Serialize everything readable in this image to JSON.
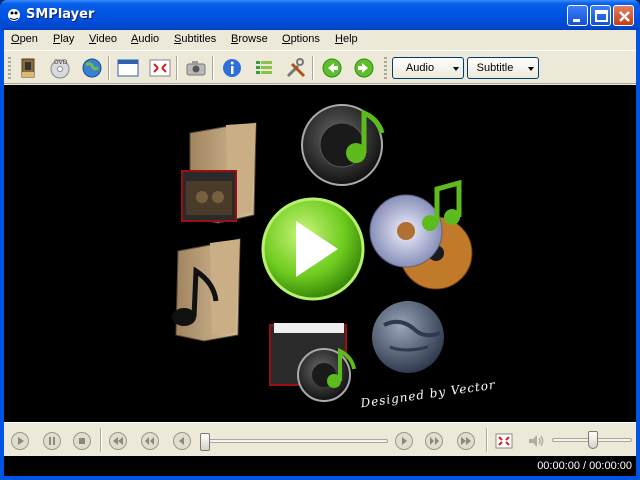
{
  "window": {
    "title": "SMPlayer"
  },
  "menu": [
    {
      "key": "O",
      "rest": "pen"
    },
    {
      "key": "P",
      "rest": "lay"
    },
    {
      "key": "V",
      "rest": "ideo"
    },
    {
      "key": "A",
      "rest": "udio"
    },
    {
      "key": "S",
      "rest": "ubtitles"
    },
    {
      "key": "B",
      "rest": "rowse"
    },
    {
      "key": "O",
      "rest": "ptions",
      "full": "Options"
    },
    {
      "key": "H",
      "rest": "elp"
    }
  ],
  "toolbar": {
    "audio_label": "Audio",
    "subtitle_label": "Subtitle"
  },
  "video": {
    "credit": "Designed by Vector"
  },
  "status": {
    "time": "00:00:00 / 00:00:00"
  },
  "colors": {
    "titlebar": "#0054e3",
    "chrome": "#ece9d8",
    "play_green": "#6ecb1e"
  },
  "icons": {
    "toolbar": [
      "open-file-icon",
      "dvd-icon",
      "url-globe-icon",
      "compact-view-icon",
      "fullscreen-icon",
      "screenshot-icon",
      "info-icon",
      "playlist-icon",
      "preferences-icon",
      "previous-icon",
      "next-icon"
    ],
    "controls": [
      "play-icon",
      "pause-icon",
      "stop-icon",
      "rewind-long-icon",
      "rewind-medium-icon",
      "rewind-short-icon",
      "forward-short-icon",
      "forward-medium-icon",
      "forward-long-icon",
      "fullscreen-icon",
      "volume-icon"
    ]
  }
}
